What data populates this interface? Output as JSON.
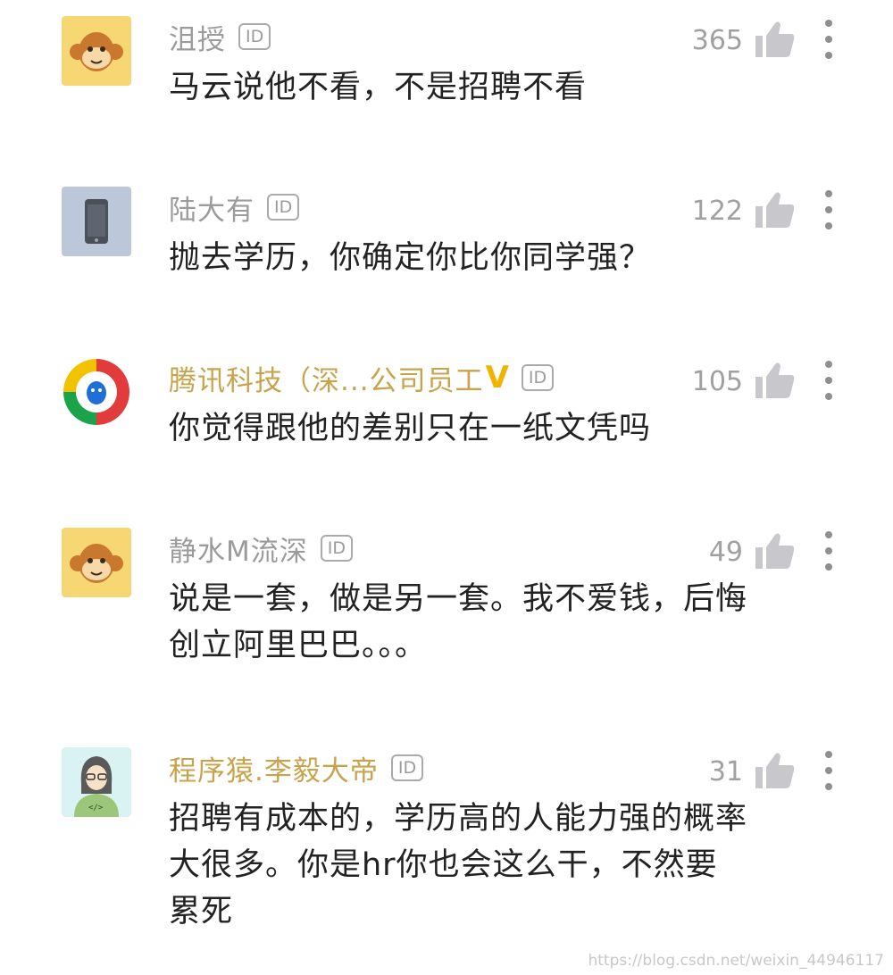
{
  "comments": [
    {
      "username": "沮授",
      "id_badge": "ID",
      "likes": "365",
      "text": "马云说他不看，不是招聘不看",
      "avatar": "monkey-avatar"
    },
    {
      "username": "陆大有",
      "id_badge": "ID",
      "likes": "122",
      "text": "抛去学历，你确定你比你同学强？",
      "avatar": "phone-avatar"
    },
    {
      "username": "腾讯科技（深...公司员工",
      "verified": "V",
      "id_badge": "ID",
      "likes": "105",
      "text": "你觉得跟他的差别只在一纸文凭吗",
      "avatar": "tencent-avatar"
    },
    {
      "username": "静水M流深",
      "id_badge": "ID",
      "likes": "49",
      "text": "说是一套，做是另一套。我不爱钱，后悔创立阿里巴巴。。。",
      "avatar": "monkey-avatar"
    },
    {
      "username": "程序猿.李毅大帝",
      "id_badge": "ID",
      "likes": "31",
      "text": "招聘有成本的，学历高的人能力强的概率大很多。你是hr你也会这么干，不然要累死",
      "avatar": "coder-avatar"
    }
  ],
  "watermark": "https://blog.csdn.net/weixin_44946117",
  "colors": {
    "username_gray": "#9b9b9b",
    "username_gold": "#c8a34c",
    "verified_gold": "#f0b400",
    "like_icon": "#c8c8cc",
    "text": "#222222"
  }
}
